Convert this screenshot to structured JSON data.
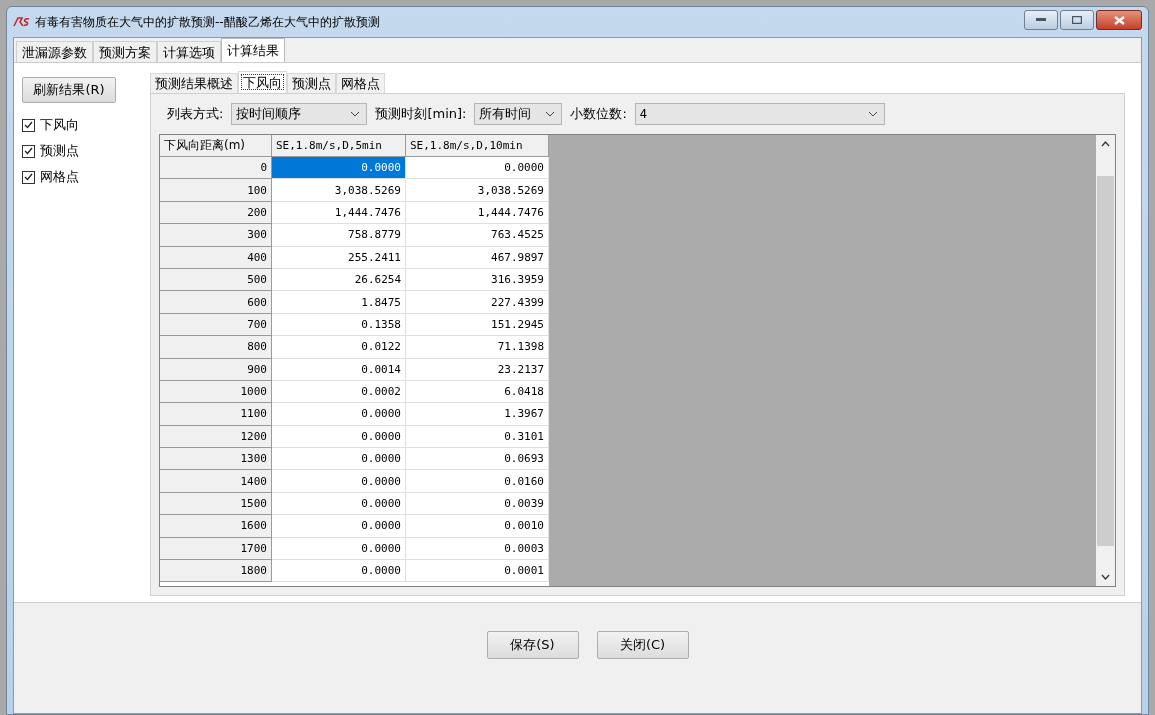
{
  "window": {
    "title": "有毒有害物质在大气中的扩散预测--醋酸乙烯在大气中的扩散预测"
  },
  "tabs": [
    {
      "label": "泄漏源参数",
      "selected": false
    },
    {
      "label": "预测方案",
      "selected": false
    },
    {
      "label": "计算选项",
      "selected": false
    },
    {
      "label": "计算结果",
      "selected": true
    }
  ],
  "refresh_button": "刷新结果(R)",
  "checkboxes": [
    {
      "label": "下风向",
      "checked": true
    },
    {
      "label": "预测点",
      "checked": true
    },
    {
      "label": "网格点",
      "checked": true
    }
  ],
  "sub_tabs": [
    {
      "label": "预测结果概述",
      "selected": false
    },
    {
      "label": "下风向",
      "selected": true
    },
    {
      "label": "预测点",
      "selected": false
    },
    {
      "label": "网格点",
      "selected": false
    }
  ],
  "toolbar": [
    {
      "label": "列表方式:",
      "value": "按时间顺序"
    },
    {
      "label": "预测时刻[min]:",
      "value": "所有时间"
    },
    {
      "label": "小数位数:",
      "value": "4"
    }
  ],
  "table": {
    "columns": [
      "下风向距离(m)",
      "SE,1.8m/s,D,5min",
      "SE,1.8m/s,D,10min"
    ],
    "rows": [
      {
        "distance": "0",
        "cells": [
          {
            "text": "0.0000",
            "selected": true
          },
          {
            "text": "0.0000",
            "selected": false
          }
        ]
      },
      {
        "distance": "100",
        "cells": [
          {
            "text": "3,038.5269",
            "selected": false
          },
          {
            "text": "3,038.5269",
            "selected": false
          }
        ]
      },
      {
        "distance": "200",
        "cells": [
          {
            "text": "1,444.7476",
            "selected": false
          },
          {
            "text": "1,444.7476",
            "selected": false
          }
        ]
      },
      {
        "distance": "300",
        "cells": [
          {
            "text": "758.8779",
            "selected": false
          },
          {
            "text": "763.4525",
            "selected": false
          }
        ]
      },
      {
        "distance": "400",
        "cells": [
          {
            "text": "255.2411",
            "selected": false
          },
          {
            "text": "467.9897",
            "selected": false
          }
        ]
      },
      {
        "distance": "500",
        "cells": [
          {
            "text": "26.6254",
            "selected": false
          },
          {
            "text": "316.3959",
            "selected": false
          }
        ]
      },
      {
        "distance": "600",
        "cells": [
          {
            "text": "1.8475",
            "selected": false
          },
          {
            "text": "227.4399",
            "selected": false
          }
        ]
      },
      {
        "distance": "700",
        "cells": [
          {
            "text": "0.1358",
            "selected": false
          },
          {
            "text": "151.2945",
            "selected": false
          }
        ]
      },
      {
        "distance": "800",
        "cells": [
          {
            "text": "0.0122",
            "selected": false
          },
          {
            "text": "71.1398",
            "selected": false
          }
        ]
      },
      {
        "distance": "900",
        "cells": [
          {
            "text": "0.0014",
            "selected": false
          },
          {
            "text": "23.2137",
            "selected": false
          }
        ]
      },
      {
        "distance": "1000",
        "cells": [
          {
            "text": "0.0002",
            "selected": false
          },
          {
            "text": "6.0418",
            "selected": false
          }
        ]
      },
      {
        "distance": "1100",
        "cells": [
          {
            "text": "0.0000",
            "selected": false
          },
          {
            "text": "1.3967",
            "selected": false
          }
        ]
      },
      {
        "distance": "1200",
        "cells": [
          {
            "text": "0.0000",
            "selected": false
          },
          {
            "text": "0.3101",
            "selected": false
          }
        ]
      },
      {
        "distance": "1300",
        "cells": [
          {
            "text": "0.0000",
            "selected": false
          },
          {
            "text": "0.0693",
            "selected": false
          }
        ]
      },
      {
        "distance": "1400",
        "cells": [
          {
            "text": "0.0000",
            "selected": false
          },
          {
            "text": "0.0160",
            "selected": false
          }
        ]
      },
      {
        "distance": "1500",
        "cells": [
          {
            "text": "0.0000",
            "selected": false
          },
          {
            "text": "0.0039",
            "selected": false
          }
        ]
      },
      {
        "distance": "1600",
        "cells": [
          {
            "text": "0.0000",
            "selected": false
          },
          {
            "text": "0.0010",
            "selected": false
          }
        ]
      },
      {
        "distance": "1700",
        "cells": [
          {
            "text": "0.0000",
            "selected": false
          },
          {
            "text": "0.0003",
            "selected": false
          }
        ]
      },
      {
        "distance": "1800",
        "cells": [
          {
            "text": "0.0000",
            "selected": false
          },
          {
            "text": "0.0001",
            "selected": false
          }
        ]
      }
    ]
  },
  "buttons": [
    "保存(S)",
    "关闭(C)"
  ]
}
